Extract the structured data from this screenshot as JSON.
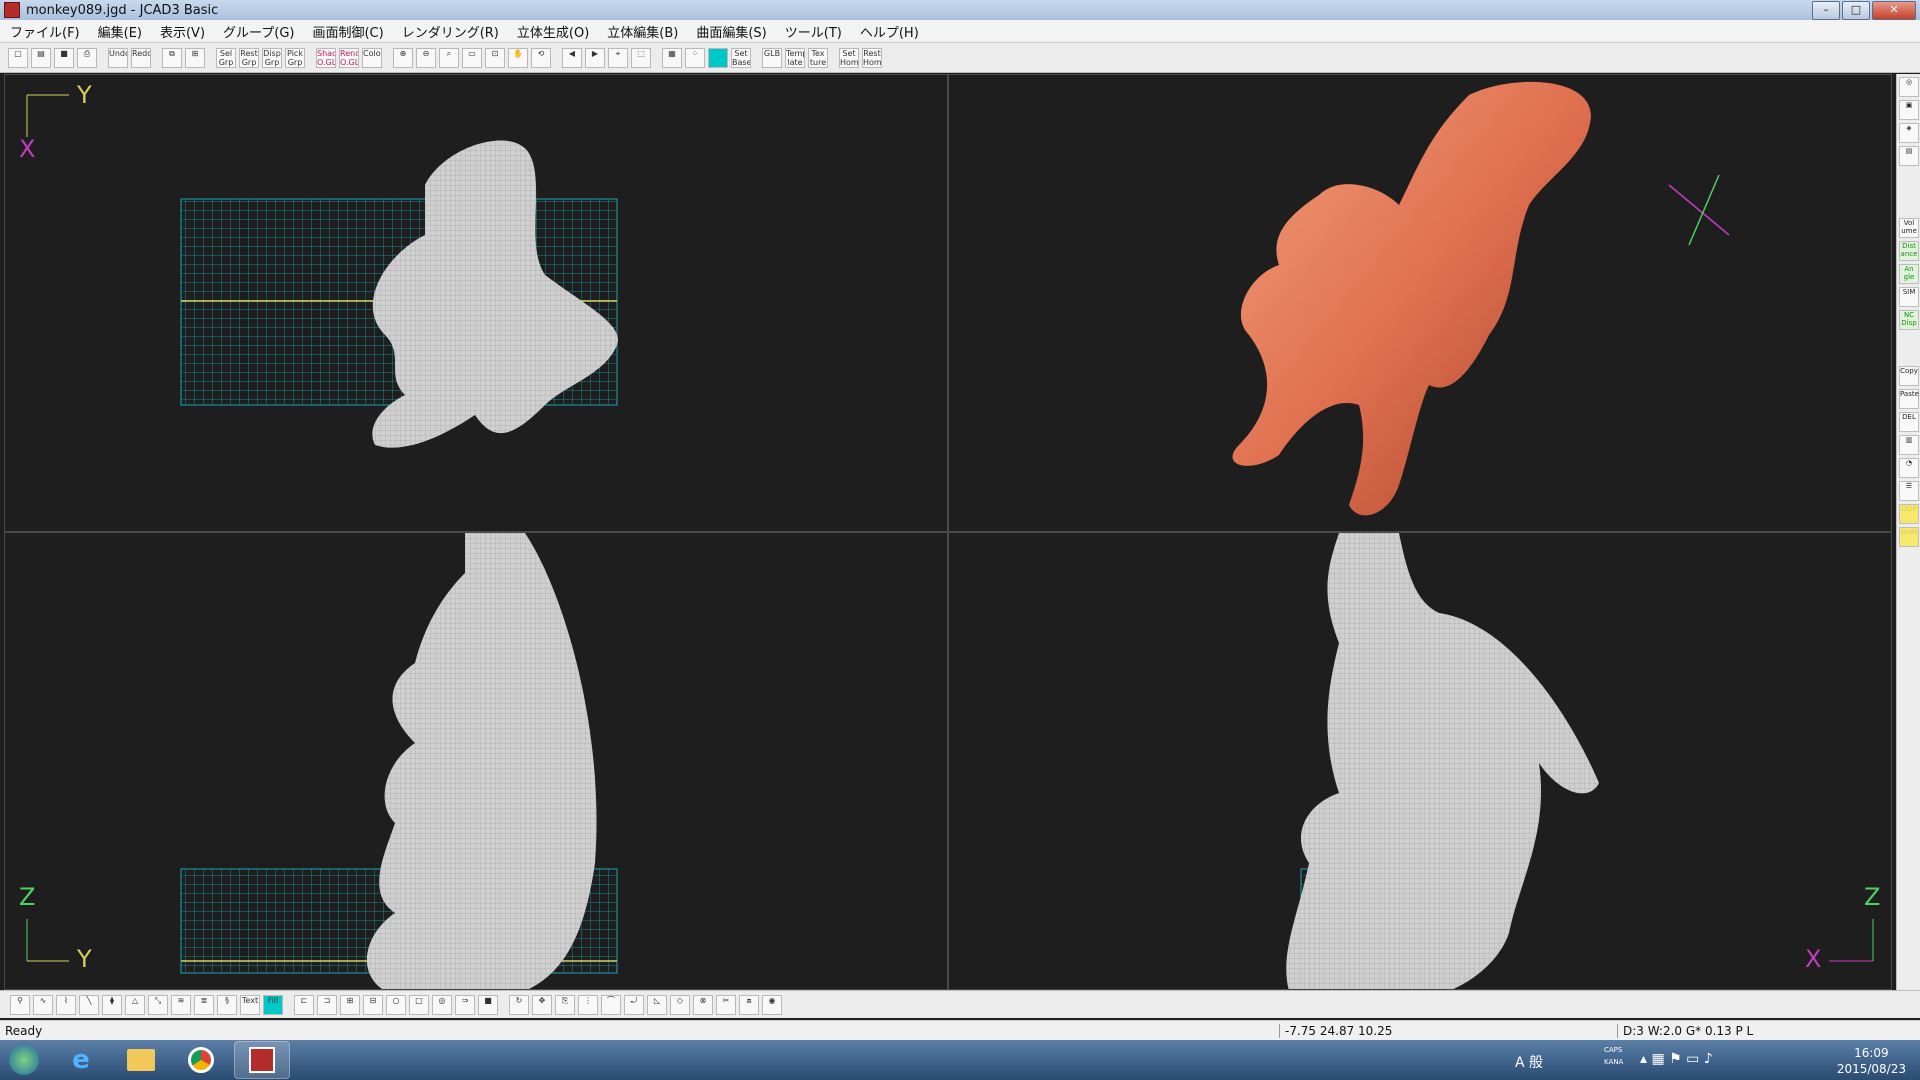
{
  "window": {
    "title": "monkey089.jgd - JCAD3 Basic",
    "controls": [
      "–",
      "□",
      "✕"
    ]
  },
  "menu": [
    "ファイル(F)",
    "編集(E)",
    "表示(V)",
    "グループ(G)",
    "画面制御(C)",
    "レンダリング(R)",
    "立体生成(O)",
    "立体編集(B)",
    "曲面編集(S)",
    "ツール(T)",
    "ヘルプ(H)"
  ],
  "toolbar_groups": [
    [
      "new-icon",
      "open-icon",
      "save-icon",
      "print-icon"
    ],
    [
      "Undo",
      "Redo"
    ],
    [
      "copy-view-icon",
      "view-layout-icon"
    ],
    [
      "Sel Grp",
      "Rest Grp",
      "Disp Grp",
      "Pick Grp"
    ],
    [
      "Shad O.GL",
      "Rend O.GL",
      "Color"
    ],
    [
      "zoom-in-icon",
      "zoom-out-icon",
      "zoom-fit-icon",
      "zoom-window-icon",
      "zoom-all-icon",
      "pan-hand-icon",
      "rotate-icon"
    ],
    [
      "zoom-prev-icon",
      "zoom-next-icon",
      "zoom-area-icon",
      "zoom-full-icon"
    ],
    [
      "grid-icon",
      "snap-icon",
      "shade-toggle-icon",
      "Set Base"
    ],
    [
      "GLB",
      "Temp late",
      "Tex ture"
    ],
    [
      "Set Home",
      "Rest Home"
    ]
  ],
  "right_toolbar": [
    "Vol ume",
    "Dist ance",
    "An gle",
    "SIM",
    "NC Disp",
    "Copy",
    "Paste",
    "DEL",
    "OOP",
    "NUM"
  ],
  "viewports": {
    "top": {
      "axis_h": "Y",
      "axis_v": "X"
    },
    "perspective": {},
    "front": {
      "axis_v": "Z",
      "axis_h": "Y"
    },
    "side": {
      "axis_v": "Z",
      "axis_h": "X"
    }
  },
  "bottom_toolbar_text": [
    "Text",
    "Fill"
  ],
  "status": {
    "ready": "Ready",
    "coords": "-7.75 24.87 10.25",
    "info": "D:3 W:2.0  G* 0.13 P   L"
  },
  "taskbar": {
    "apps": [
      "start-orb",
      "ie-icon",
      "explorer-icon",
      "chrome-icon",
      "jcad-icon"
    ],
    "ime": "A 般",
    "time": "16:09",
    "date": "2015/08/23",
    "caps": "CAPS",
    "kana": "KANA"
  },
  "colors": {
    "model_wire": "#cfcfcf",
    "grid": "#1aa6b8",
    "model_render": "#e07050",
    "axis_yellow": "#d8d05f",
    "axis_magenta": "#c43bc4",
    "axis_green": "#4fd25e"
  }
}
